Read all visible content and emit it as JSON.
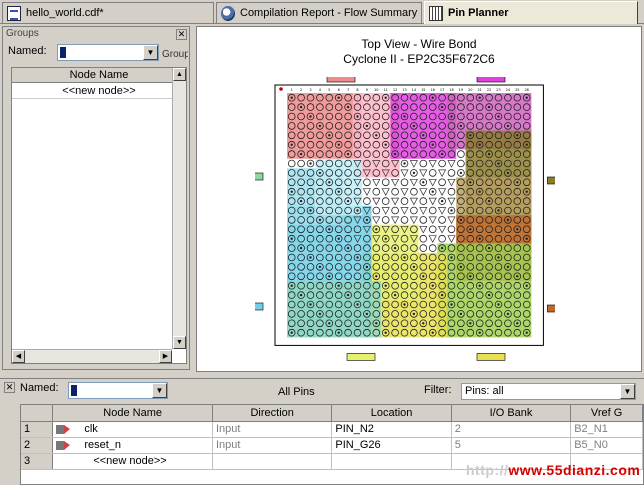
{
  "tabs": [
    {
      "label": "hello_world.cdf*",
      "icon": "document-icon"
    },
    {
      "label": "Compilation Report - Flow Summary",
      "icon": "report-icon"
    },
    {
      "label": "Pin Planner",
      "icon": "pin-planner-icon",
      "active": true
    }
  ],
  "groups": {
    "title": "Groups",
    "named_label": "Named:",
    "named_value": "*",
    "group_button": "Group",
    "column": "Node Name",
    "new_node": "<<new node>>"
  },
  "planner": {
    "title": "Top View - Wire Bond",
    "subtitle": "Cyclone II - EP2C35F672C6",
    "rows": 26,
    "cols": 26
  },
  "pins": {
    "named_label": "Named:",
    "named_value": "*",
    "center_title": "All Pins",
    "filter_label": "Filter:",
    "filter_value": "Pins: all",
    "columns": [
      "Node Name",
      "Direction",
      "Location",
      "I/O Bank",
      "Vref G"
    ],
    "rows": [
      {
        "num": "1",
        "name": "clk",
        "direction": "Input",
        "location": "PIN_N2",
        "bank": "2",
        "vref": "B2_N1"
      },
      {
        "num": "2",
        "name": "reset_n",
        "direction": "Input",
        "location": "PIN_G26",
        "bank": "5",
        "vref": "B5_N0"
      },
      {
        "num": "3",
        "name": "<<new node>>",
        "direction": "",
        "location": "",
        "bank": "",
        "vref": ""
      }
    ]
  },
  "watermark": {
    "prefix": "http://",
    "site": "www.55dianzi.com"
  }
}
